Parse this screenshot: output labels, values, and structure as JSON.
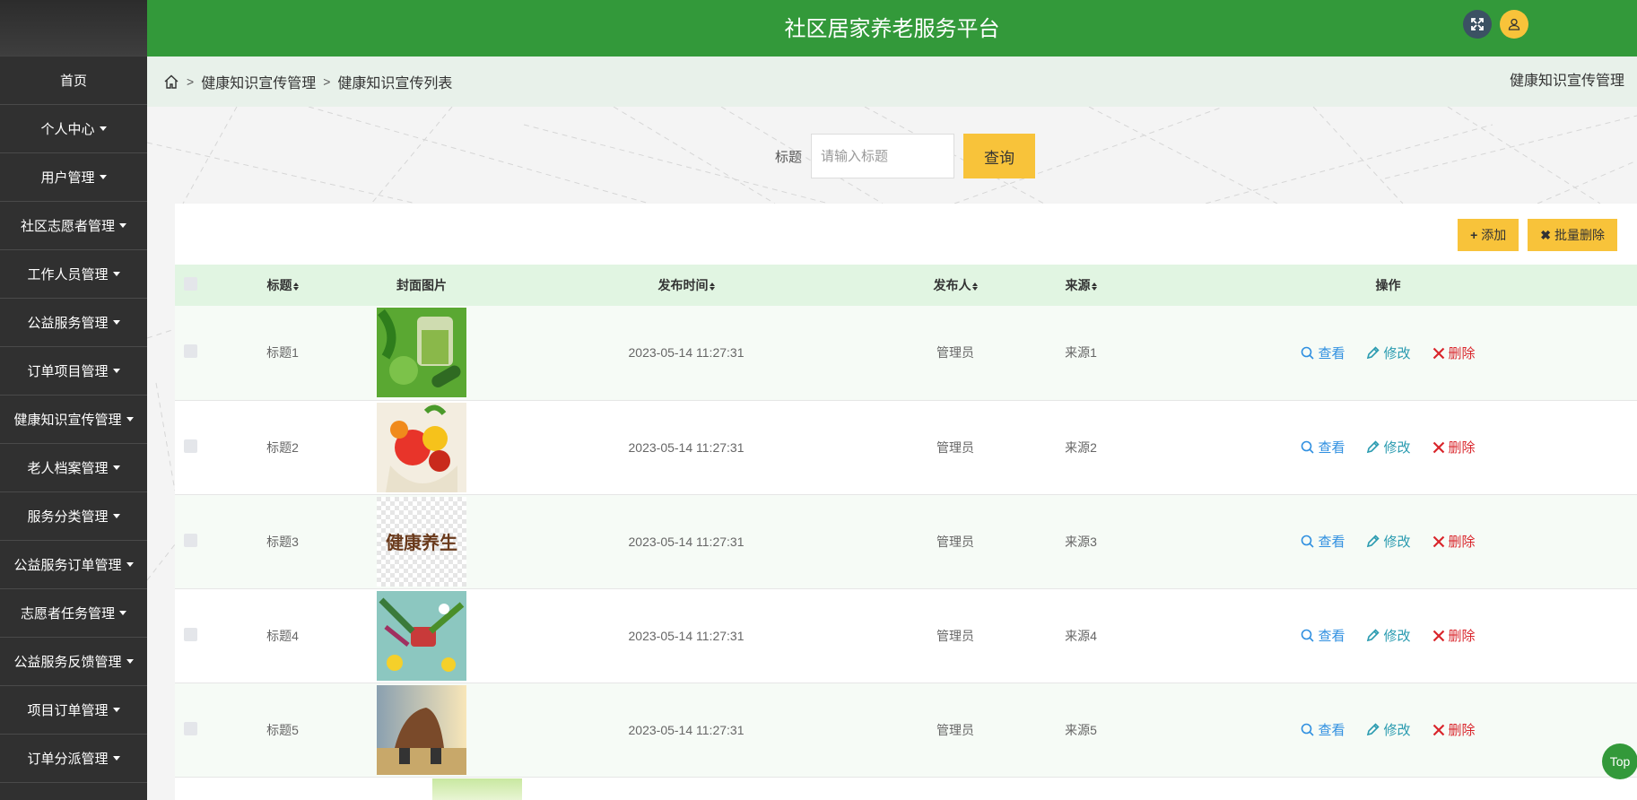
{
  "app": {
    "title": "社区居家养老服务平台"
  },
  "header": {
    "fullscreen_icon": "expand-icon",
    "user_icon": "user-icon"
  },
  "sidebar": {
    "items": [
      {
        "label": "首页",
        "dropdown": false
      },
      {
        "label": "个人中心",
        "dropdown": true
      },
      {
        "label": "用户管理",
        "dropdown": true
      },
      {
        "label": "社区志愿者管理",
        "dropdown": true
      },
      {
        "label": "工作人员管理",
        "dropdown": true
      },
      {
        "label": "公益服务管理",
        "dropdown": true
      },
      {
        "label": "订单项目管理",
        "dropdown": true
      },
      {
        "label": "健康知识宣传管理",
        "dropdown": true
      },
      {
        "label": "老人档案管理",
        "dropdown": true
      },
      {
        "label": "服务分类管理",
        "dropdown": true
      },
      {
        "label": "公益服务订单管理",
        "dropdown": true
      },
      {
        "label": "志愿者任务管理",
        "dropdown": true
      },
      {
        "label": "公益服务反馈管理",
        "dropdown": true
      },
      {
        "label": "项目订单管理",
        "dropdown": true
      },
      {
        "label": "订单分派管理",
        "dropdown": true
      }
    ]
  },
  "breadcrumb": {
    "sep": ">",
    "items": [
      "健康知识宣传管理",
      "健康知识宣传列表"
    ],
    "right_title": "健康知识宣传管理"
  },
  "search": {
    "label": "标题",
    "placeholder": "请输入标题",
    "value": "",
    "button_label": "查询"
  },
  "actions": {
    "add_label": "添加",
    "batch_delete_label": "批量删除"
  },
  "table": {
    "columns": [
      "标题",
      "封面图片",
      "发布时间",
      "发布人",
      "来源",
      "操作"
    ],
    "op_labels": {
      "view": "查看",
      "edit": "修改",
      "delete": "删除"
    },
    "rows": [
      {
        "title": "标题1",
        "time": "2023-05-14 11:27:31",
        "publisher": "管理员",
        "source": "来源1"
      },
      {
        "title": "标题2",
        "time": "2023-05-14 11:27:31",
        "publisher": "管理员",
        "source": "来源2"
      },
      {
        "title": "标题3",
        "time": "2023-05-14 11:27:31",
        "publisher": "管理员",
        "source": "来源3"
      },
      {
        "title": "标题4",
        "time": "2023-05-14 11:27:31",
        "publisher": "管理员",
        "source": "来源4"
      },
      {
        "title": "标题5",
        "time": "2023-05-14 11:27:31",
        "publisher": "管理员",
        "source": "来源5"
      }
    ],
    "cover_logo_text": "健康养生"
  },
  "top_button": {
    "label": "Top"
  },
  "colors": {
    "header": "#33993a",
    "sidebar": "#303030",
    "accent_button": "#f8c33a",
    "view": "#2f8fe0",
    "edit": "#2a9bb0",
    "delete": "#d9252b"
  }
}
